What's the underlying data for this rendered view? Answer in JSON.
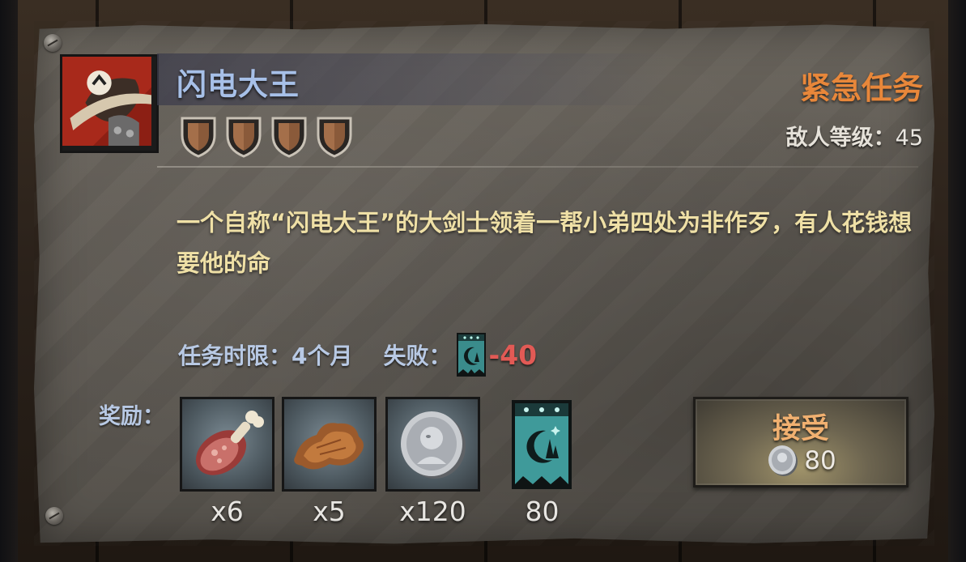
{
  "quest": {
    "title": "闪电大王",
    "type_label": "紧急任务",
    "enemy_level_label": "敌人等级：",
    "enemy_level_value": "45",
    "difficulty_shields": 4,
    "description": "一个自称“闪电大王”的大剑士领着一帮小弟四处为非作歹，有人花钱想要他的命",
    "time_limit_label": "任务时限：",
    "time_limit_value": "4个月",
    "fail_label": "失败：",
    "fail_value": "-40"
  },
  "rewards": {
    "label": "奖励：",
    "items": [
      {
        "icon": "meat-leg-icon",
        "count": "x6"
      },
      {
        "icon": "jerky-icon",
        "count": "x5"
      },
      {
        "icon": "silver-coin-icon",
        "count": "x120"
      },
      {
        "icon": "moon-banner-icon",
        "count": "80"
      }
    ]
  },
  "accept_button": {
    "label": "接受",
    "cost": "80",
    "cost_icon": "silver-coin-icon"
  },
  "colors": {
    "title": "#a7c0e8",
    "urgent": "#e8873a",
    "description": "#efe0a6",
    "fail_value": "#e25a55",
    "label_blue": "#b8c9e4",
    "accept_label": "#f0b070"
  }
}
